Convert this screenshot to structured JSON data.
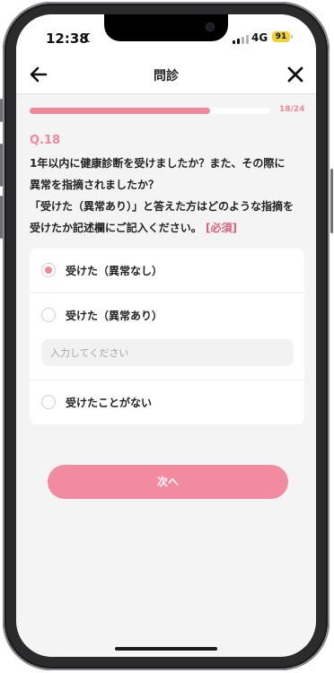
{
  "status_bar": {
    "time": "12:38",
    "network": "4G",
    "battery": "91"
  },
  "header": {
    "title": "問診"
  },
  "progress": {
    "label": "18/24",
    "fraction": 0.75
  },
  "question": {
    "number": "Q.18",
    "line1": "1年以内に健康診断を受けましたか？また、その際に",
    "line2": "異常を指摘されましたか？",
    "line3": "「受けた（異常あり）」と答えた方はどのような指摘を",
    "line4": "受けたか記述欄にご記入ください。",
    "required": "[必須]"
  },
  "options": [
    {
      "label": "受けた（異常なし）",
      "selected": true
    },
    {
      "label": "受けた（異常あり）",
      "selected": false
    },
    {
      "label": "受けたことがない",
      "selected": false
    }
  ],
  "detail_input": {
    "placeholder": "入力してください",
    "value": ""
  },
  "next_button": {
    "label": "次へ"
  },
  "icons": {
    "back": "arrow-left-icon",
    "close": "close-icon",
    "moon": "moon-icon"
  },
  "colors": {
    "accent": "#ef8898",
    "button": "#f28ba0",
    "battery": "#f2d230"
  }
}
